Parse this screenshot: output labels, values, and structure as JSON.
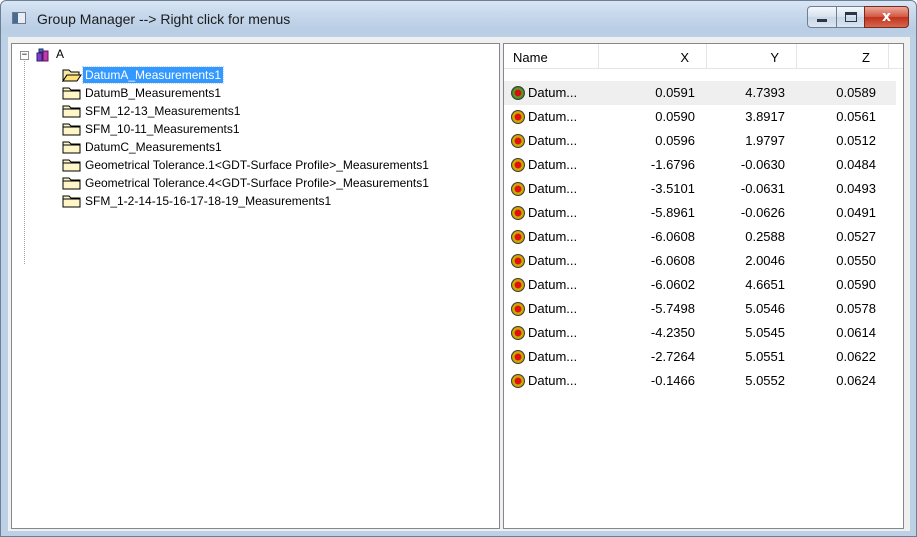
{
  "window": {
    "title": "Group Manager --> Right click for menus"
  },
  "controls": {
    "close_glyph": "x"
  },
  "tree": {
    "root": {
      "expander": "−",
      "label": "A"
    },
    "items": [
      {
        "label": "DatumA_Measurements1",
        "selected": true,
        "open": true
      },
      {
        "label": "DatumB_Measurements1"
      },
      {
        "label": "SFM_12-13_Measurements1"
      },
      {
        "label": "SFM_10-11_Measurements1"
      },
      {
        "label": "DatumC_Measurements1"
      },
      {
        "label": "Geometrical Tolerance.1<GDT-Surface Profile>_Measurements1"
      },
      {
        "label": "Geometrical Tolerance.4<GDT-Surface Profile>_Measurements1"
      },
      {
        "label": "SFM_1-2-14-15-16-17-18-19_Measurements1"
      }
    ]
  },
  "list": {
    "columns": [
      "Name",
      "X",
      "Y",
      "Z"
    ],
    "rows": [
      {
        "name": "Datum...",
        "x": "0.0591",
        "y": "4.7393",
        "z": "0.0589"
      },
      {
        "name": "Datum...",
        "x": "0.0590",
        "y": "3.8917",
        "z": "0.0561"
      },
      {
        "name": "Datum...",
        "x": "0.0596",
        "y": "1.9797",
        "z": "0.0512"
      },
      {
        "name": "Datum...",
        "x": "-1.6796",
        "y": "-0.0630",
        "z": "0.0484"
      },
      {
        "name": "Datum...",
        "x": "-3.5101",
        "y": "-0.0631",
        "z": "0.0493"
      },
      {
        "name": "Datum...",
        "x": "-5.8961",
        "y": "-0.0626",
        "z": "0.0491"
      },
      {
        "name": "Datum...",
        "x": "-6.0608",
        "y": "0.2588",
        "z": "0.0527"
      },
      {
        "name": "Datum...",
        "x": "-6.0608",
        "y": "2.0046",
        "z": "0.0550"
      },
      {
        "name": "Datum...",
        "x": "-6.0602",
        "y": "4.6651",
        "z": "0.0590"
      },
      {
        "name": "Datum...",
        "x": "-5.7498",
        "y": "5.0546",
        "z": "0.0578"
      },
      {
        "name": "Datum...",
        "x": "-4.2350",
        "y": "5.0545",
        "z": "0.0614"
      },
      {
        "name": "Datum...",
        "x": "-2.7264",
        "y": "5.0551",
        "z": "0.0622"
      },
      {
        "name": "Datum...",
        "x": "-0.1466",
        "y": "5.0552",
        "z": "0.0624"
      }
    ]
  },
  "icons": {
    "title": "window-app-icon",
    "root": "assembly-icon",
    "folder_open": "folder-open-icon",
    "folder": "folder-icon",
    "point": "measured-point-icon"
  },
  "colors": {
    "selection": "#3399ff",
    "point_fill": "#d6b600",
    "point_center": "#e01010",
    "close_button": "#c0321b"
  }
}
